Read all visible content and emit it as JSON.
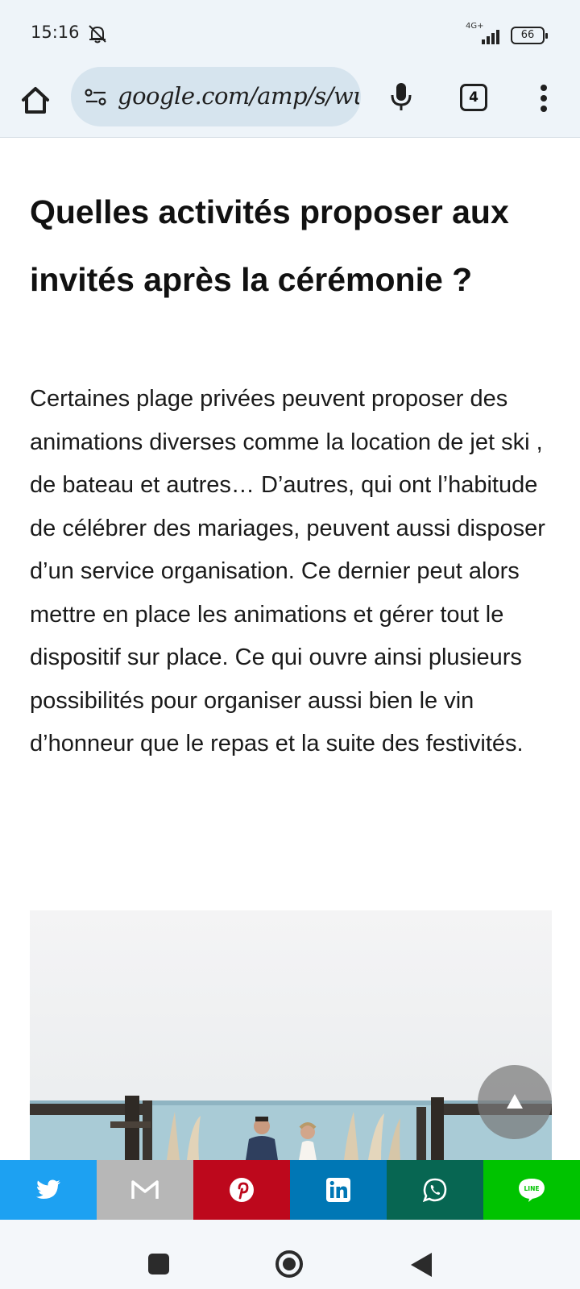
{
  "status_bar": {
    "time": "15:16",
    "network": "4G+",
    "battery": "66"
  },
  "browser": {
    "url": "google.com/amp/s/wu",
    "tab_count": "4"
  },
  "article": {
    "heading": "Quelles activités proposer aux invités après la cérémonie ?",
    "paragraph": "Certaines plage privées peuvent proposer des animations diverses comme la location de jet ski , de bateau et autres… D’autres, qui ont l’habitude de célébrer des mariages, peuvent aussi disposer d’un service organisation. Ce dernier peut alors mettre en place les animations et gérer tout le dispositif sur place. Ce qui ouvre ainsi plusieurs possibilités pour organiser aussi bien le vin d’honneur que le repas et la suite des festivités."
  },
  "share_bar": {
    "colors": {
      "twitter": "#1da1f2",
      "gmail": "#b7b7b7",
      "pinterest": "#bd081c",
      "linkedin": "#0077b5",
      "whatsapp": "#076652",
      "line": "#00c300"
    }
  }
}
